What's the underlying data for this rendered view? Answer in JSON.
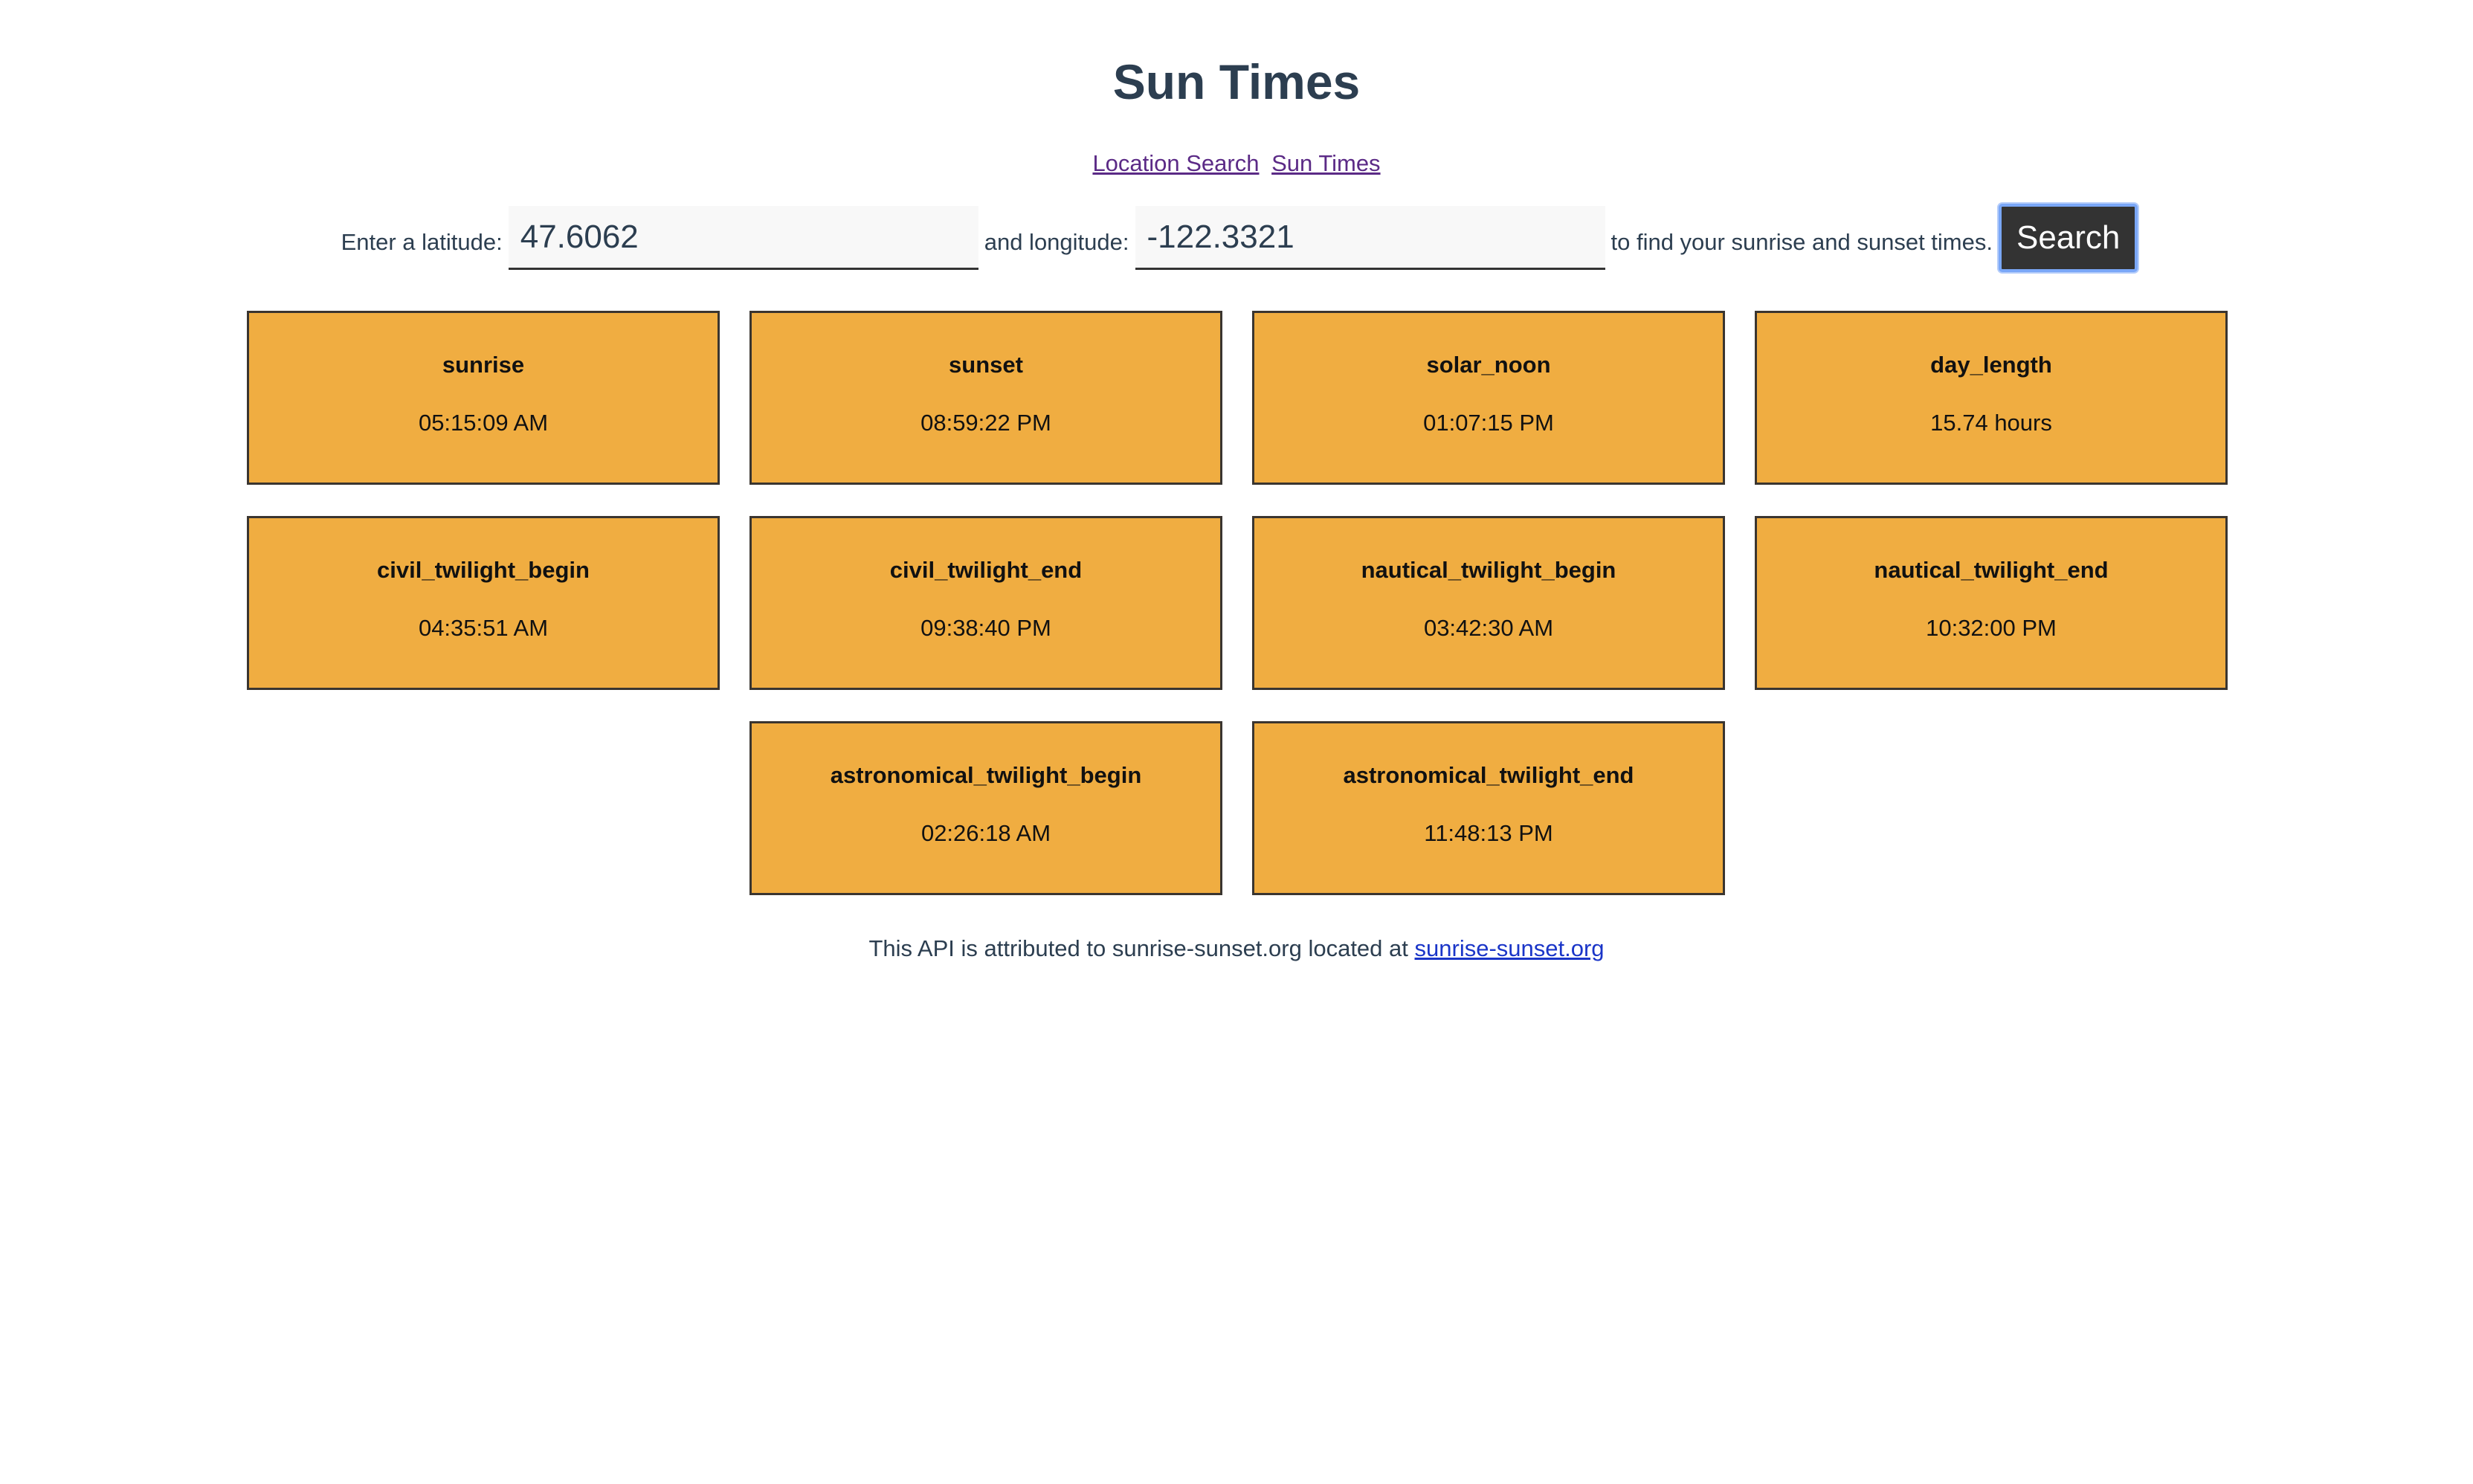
{
  "header": {
    "title": "Sun Times"
  },
  "nav": {
    "links": [
      {
        "label": "Location Search"
      },
      {
        "label": "Sun Times"
      }
    ]
  },
  "form": {
    "latitude_label": "Enter a latitude:",
    "latitude_value": "47.6062",
    "longitude_label": "and longitude:",
    "longitude_value": "-122.3321",
    "suffix_text": "to find your sunrise and sunset times.",
    "search_label": "Search"
  },
  "results": [
    {
      "key": "sunrise",
      "value": "05:15:09 AM"
    },
    {
      "key": "sunset",
      "value": "08:59:22 PM"
    },
    {
      "key": "solar_noon",
      "value": "01:07:15 PM"
    },
    {
      "key": "day_length",
      "value": "15.74 hours"
    },
    {
      "key": "civil_twilight_begin",
      "value": "04:35:51 AM"
    },
    {
      "key": "civil_twilight_end",
      "value": "09:38:40 PM"
    },
    {
      "key": "nautical_twilight_begin",
      "value": "03:42:30 AM"
    },
    {
      "key": "nautical_twilight_end",
      "value": "10:32:00 PM"
    },
    {
      "key": "astronomical_twilight_begin",
      "value": "02:26:18 AM"
    },
    {
      "key": "astronomical_twilight_end",
      "value": "11:48:13 PM"
    }
  ],
  "footer": {
    "text": "This API is attributed to sunrise-sunset.org located at",
    "link_label": "sunrise-sunset.org"
  },
  "colors": {
    "card_bg": "#f0ad41",
    "button_bg": "#333333",
    "link": "#5b2a86",
    "footer_link": "#1a35c8"
  }
}
